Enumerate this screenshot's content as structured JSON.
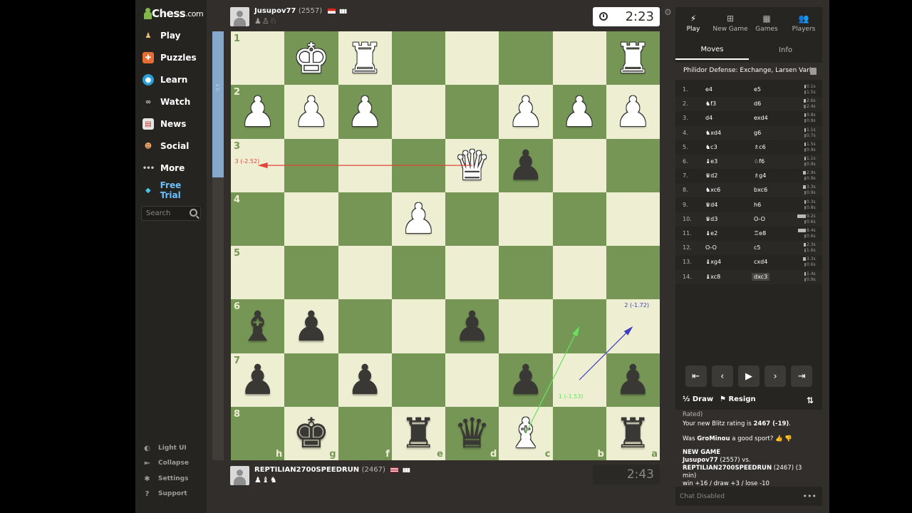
{
  "sidebar": {
    "logo": "Chess",
    "logo_suffix": ".com",
    "items": [
      {
        "label": "Play",
        "icon": "play-icon"
      },
      {
        "label": "Puzzles",
        "icon": "puzzles-icon"
      },
      {
        "label": "Learn",
        "icon": "learn-icon"
      },
      {
        "label": "Watch",
        "icon": "watch-icon"
      },
      {
        "label": "News",
        "icon": "news-icon"
      },
      {
        "label": "Social",
        "icon": "social-icon"
      },
      {
        "label": "More",
        "icon": "more-icon"
      },
      {
        "label": "Free Trial",
        "icon": "diamond-icon"
      }
    ],
    "search_placeholder": "Search",
    "bottom": [
      {
        "label": "Light UI",
        "icon": "light-ui-icon"
      },
      {
        "label": "Collapse",
        "icon": "collapse-icon"
      },
      {
        "label": "Settings",
        "icon": "settings-icon"
      },
      {
        "label": "Support",
        "icon": "support-icon"
      }
    ]
  },
  "top_player": {
    "name": "Jusupov77",
    "rating": "(2557)",
    "captured": "♟♙♘",
    "clock": "2:23"
  },
  "bottom_player": {
    "name": "REPTILIAN2700SPEEDRUN",
    "rating": "(2467)",
    "captured": "♟♝♞",
    "clock": "2:43"
  },
  "board": {
    "orientation": "black",
    "ranks": [
      "1",
      "2",
      "3",
      "4",
      "5",
      "6",
      "7",
      "8"
    ],
    "files": [
      "h",
      "g",
      "f",
      "e",
      "d",
      "c",
      "b",
      "a"
    ],
    "pieces": [
      {
        "sq": "g1",
        "p": "♚",
        "color": "w"
      },
      {
        "sq": "f1",
        "p": "♜",
        "color": "w"
      },
      {
        "sq": "a1",
        "p": "♜",
        "color": "w"
      },
      {
        "sq": "h2",
        "p": "♟",
        "color": "w"
      },
      {
        "sq": "g2",
        "p": "♟",
        "color": "w"
      },
      {
        "sq": "f2",
        "p": "♟",
        "color": "w"
      },
      {
        "sq": "c2",
        "p": "♟",
        "color": "w"
      },
      {
        "sq": "b2",
        "p": "♟",
        "color": "w"
      },
      {
        "sq": "a2",
        "p": "♟",
        "color": "w"
      },
      {
        "sq": "d3",
        "p": "♛",
        "color": "w"
      },
      {
        "sq": "c3",
        "p": "♟",
        "color": "b"
      },
      {
        "sq": "e4",
        "p": "♟",
        "color": "w"
      },
      {
        "sq": "h6",
        "p": "♝",
        "color": "b"
      },
      {
        "sq": "g6",
        "p": "♟",
        "color": "b"
      },
      {
        "sq": "d6",
        "p": "♟",
        "color": "b"
      },
      {
        "sq": "h7",
        "p": "♟",
        "color": "b"
      },
      {
        "sq": "f7",
        "p": "♟",
        "color": "b"
      },
      {
        "sq": "c7",
        "p": "♟",
        "color": "b"
      },
      {
        "sq": "a7",
        "p": "♟",
        "color": "b"
      },
      {
        "sq": "g8",
        "p": "♚",
        "color": "b"
      },
      {
        "sq": "e8",
        "p": "♜",
        "color": "b"
      },
      {
        "sq": "d8",
        "p": "♛",
        "color": "b"
      },
      {
        "sq": "c8",
        "p": "♝",
        "color": "w"
      },
      {
        "sq": "a8",
        "p": "♜",
        "color": "b"
      }
    ],
    "arrows": [
      {
        "from": "d3",
        "to": "h3",
        "color": "#e0453b",
        "label": "3 (-2.52)"
      },
      {
        "from": "c8",
        "to": "b6",
        "color": "#67e35d",
        "label": "1 (-1.53)"
      },
      {
        "from": "b7",
        "to": "a6",
        "color": "#3c3cc7",
        "label": "2 (-1.72)"
      }
    ]
  },
  "eval_fill": 0.34,
  "eval_label": "-2.5",
  "panel": {
    "tabs": [
      {
        "label": "Play",
        "icon": "bolt-icon"
      },
      {
        "label": "New Game",
        "icon": "plus-icon"
      },
      {
        "label": "Games",
        "icon": "games-icon"
      },
      {
        "label": "Players",
        "icon": "players-icon"
      }
    ],
    "subtabs": [
      "Moves",
      "Info"
    ],
    "opening": "Philidor Defense: Exchange, Larsen Vari...",
    "moves": [
      {
        "n": "1.",
        "w": "e4",
        "b": "e5",
        "t": [
          "0.1s",
          "1.5s"
        ]
      },
      {
        "n": "2.",
        "w": "♞f3",
        "b": "d6",
        "t": [
          "2.6s",
          "2.4s"
        ]
      },
      {
        "n": "3.",
        "w": "d4",
        "b": "exd4",
        "t": [
          "0.8s",
          "0.9s"
        ]
      },
      {
        "n": "4.",
        "w": "♞xd4",
        "b": "g6",
        "t": [
          "1.1s",
          "0.7s"
        ]
      },
      {
        "n": "5.",
        "w": "♞c3",
        "b": "♗c6",
        "t": [
          "1.5s",
          "0.9s"
        ]
      },
      {
        "n": "6.",
        "w": "♝e3",
        "b": "♘f6",
        "t": [
          "1.1s",
          "0.9s"
        ]
      },
      {
        "n": "7.",
        "w": "♛d2",
        "b": "♗g4",
        "t": [
          "2.9s",
          "0.9s"
        ]
      },
      {
        "n": "8.",
        "w": "♞xc6",
        "b": "bxc6",
        "t": [
          "3.3s",
          "0.9s"
        ]
      },
      {
        "n": "9.",
        "w": "♛d4",
        "b": "h6",
        "t": [
          "0.3s",
          "0.8s"
        ]
      },
      {
        "n": "10.",
        "w": "♛d3",
        "b": "O-O",
        "t": [
          "9.2s",
          "0.6s"
        ]
      },
      {
        "n": "11.",
        "w": "♝e2",
        "b": "♖e8",
        "t": [
          "8.4s",
          "0.6s"
        ]
      },
      {
        "n": "12.",
        "w": "O-O",
        "b": "c5",
        "t": [
          "2.3s",
          "1.6s"
        ]
      },
      {
        "n": "13.",
        "w": "♝xg4",
        "b": "cxd4",
        "t": [
          "3.3s",
          "0.6s"
        ]
      },
      {
        "n": "14.",
        "w": "♝xc8",
        "b": "dxc3",
        "t": [
          "1.4s",
          "0.9s"
        ]
      }
    ],
    "draw_label": "Draw",
    "resign_label": "Resign",
    "half": "½",
    "chat": {
      "rated": "Rated)",
      "rating_line_pre": "Your new Blitz rating is ",
      "rating_value": "2467 (-19)",
      "rating_line_post": ".",
      "sport_pre": "Was ",
      "sport_name": "GroMinou",
      "sport_post": " a good sport?",
      "new_game": "NEW GAME",
      "p1": "Jusupov77",
      "p1_rating": "(2557) vs.",
      "p2": "REPTILIAN2700SPEEDRUN",
      "p2_rating": "(2467) (3 min)",
      "result_line": "win +16 / draw +3 / lose -10"
    },
    "chat_disabled": "Chat Disabled"
  }
}
